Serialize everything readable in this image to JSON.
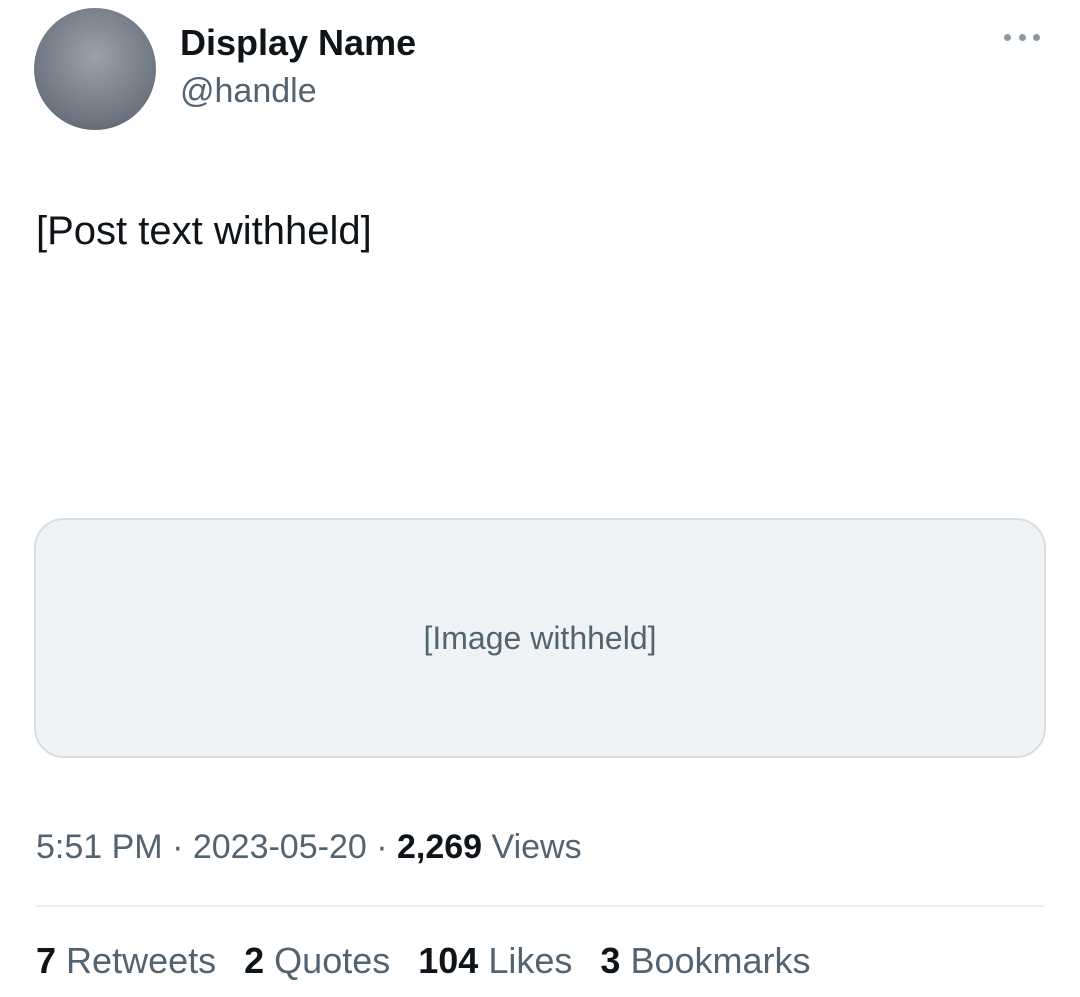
{
  "author": {
    "display_name": "Display Name",
    "handle": "@handle"
  },
  "tweet": {
    "text": "[Post text withheld]",
    "media_caption": "[Image withheld]"
  },
  "meta": {
    "time": "5:51 PM",
    "date": "2023-05-20",
    "views_count": "2,269",
    "views_label": "Views"
  },
  "stats": [
    {
      "count": "7",
      "label": "Retweets"
    },
    {
      "count": "2",
      "label": "Quotes"
    },
    {
      "count": "104",
      "label": "Likes"
    },
    {
      "count": "3",
      "label": "Bookmarks"
    }
  ]
}
